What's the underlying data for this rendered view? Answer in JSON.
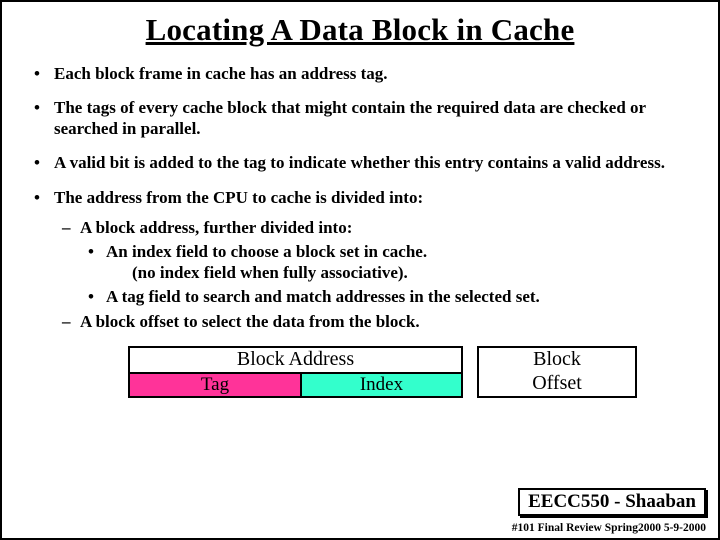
{
  "title": "Locating A Data Block in Cache",
  "bullets": {
    "b1": "Each block frame in cache has an address tag.",
    "b2": "The tags of every cache block that might contain the required data are checked or searched in parallel.",
    "b3": "A valid bit is added to the tag to indicate whether this entry contains a valid address.",
    "b4": "The address from the CPU to cache is divided into:",
    "b4_s1": "A block address, further divided into:",
    "b4_s1_a": "An index field to choose  a block set in cache.",
    "b4_s1_paren": "(no index field when fully associative).",
    "b4_s1_b": "A tag field to search and match addresses in the selected set.",
    "b4_s2": "A block offset to select the data from the block."
  },
  "diagram": {
    "block_address": "Block Address",
    "tag": "Tag",
    "index": "Index",
    "block_offset_top": "Block",
    "block_offset_bot": "Offset"
  },
  "footer": {
    "course": "EECC550 - Shaaban",
    "meta": "#101 Final Review   Spring2000  5-9-2000"
  }
}
